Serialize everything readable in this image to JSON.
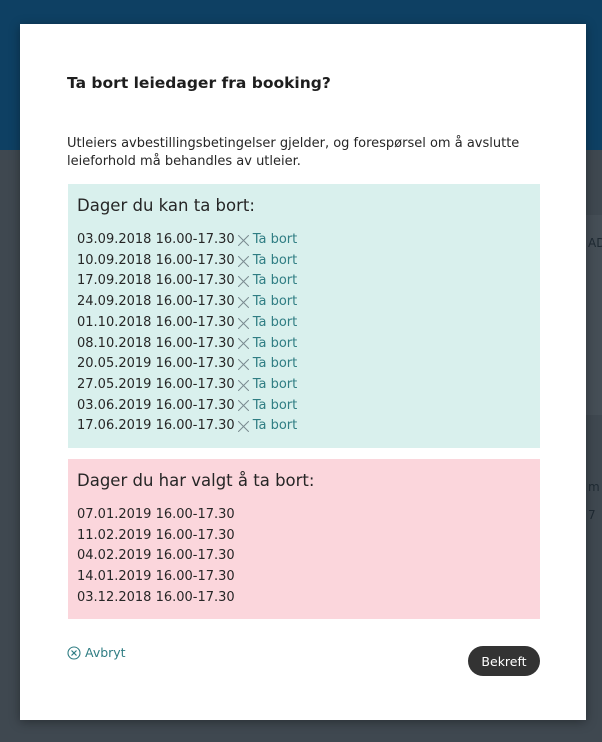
{
  "modal": {
    "title": "Ta bort leiedager fra booking?",
    "description": "Utleiers avbestillingsbetingelser gjelder, og forespørsel om å avslutte leieforhold må behandles av utleier.",
    "available": {
      "heading": "Dager du kan ta bort:",
      "remove_label": "Ta bort",
      "dates": [
        "03.09.2018 16.00-17.30",
        "10.09.2018 16.00-17.30",
        "17.09.2018 16.00-17.30",
        "24.09.2018 16.00-17.30",
        "01.10.2018 16.00-17.30",
        "08.10.2018 16.00-17.30",
        "20.05.2019 16.00-17.30",
        "27.05.2019 16.00-17.30",
        "03.06.2019 16.00-17.30",
        "17.06.2019 16.00-17.30"
      ]
    },
    "selected": {
      "heading": "Dager du har valgt å ta bort:",
      "dates": [
        "07.01.2019 16.00-17.30",
        "11.02.2019 16.00-17.30",
        "04.02.2019 16.00-17.30",
        "14.01.2019 16.00-17.30",
        "03.12.2018 16.00-17.30"
      ]
    },
    "cancel_label": "Avbryt",
    "confirm_label": "Bekreft"
  },
  "background": {
    "peek_text_1": "AD",
    "peek_text_2": "m",
    "peek_text_3": "7"
  },
  "colors": {
    "header_bg": "#0e4063",
    "available_bg": "#d9f0ed",
    "selected_bg": "#fbd6dc",
    "link": "#2f7d83",
    "confirm_bg": "#333333"
  },
  "icons": {
    "remove": "x-icon",
    "cancel": "circle-x-icon"
  }
}
